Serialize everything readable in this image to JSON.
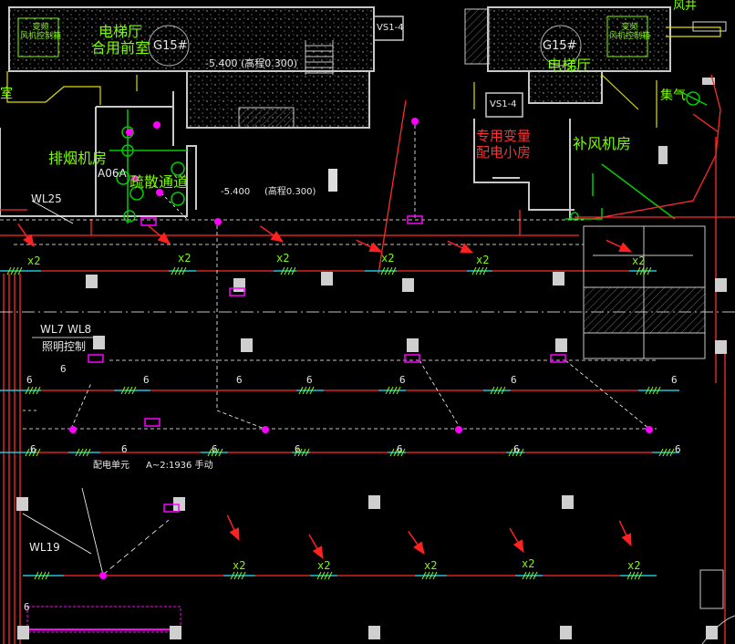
{
  "colors": {
    "background": "#000000",
    "wall": "#c8c8c8",
    "room_text": "#7CFC00",
    "duct": "#ff2a2a",
    "conduit": "#00e5ff",
    "device": "#ff00ff",
    "arrow": "#ff2020",
    "equipment": "#00cc00",
    "dim": "#ffffff"
  },
  "labels": {
    "elevator_hall_front": "电梯厅\n合用前室",
    "elevator_hall": "电梯厅",
    "g15_left": "G15#",
    "g15_right": "G15#",
    "level_left": "-5.400 (高程0.300)",
    "smoke_exhaust_room": "排烟机房",
    "make_up_air_room": "补风机房",
    "special_distribution": "专用变量\n配电小房",
    "evacuation_passage": "疏散通道",
    "collect_well": "集气",
    "a06a": "A06A",
    "level_mid": "-5.400",
    "elevation_mid": "(高程0.300)",
    "wl25": "WL25",
    "wl7_wl8": "WL7  WL8",
    "lighting_control": "照明控制",
    "wl19": "WL19",
    "a_note": "A~2:1936  手动",
    "distribution_note": "配电单元",
    "vs1_left": "VS1-4",
    "vs1_right": "VS1-4",
    "wind_top": "风井",
    "room_left_edge": "室",
    "left_box_text": "变频\n风机控制箱",
    "right_box_text": "变频\n风机控制箱"
  },
  "counts": {
    "row1": "6",
    "row2": "6"
  },
  "multipliers": {
    "x2": "x2"
  }
}
